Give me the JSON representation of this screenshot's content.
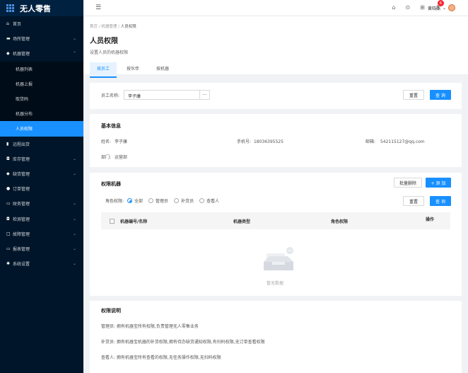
{
  "app": {
    "title": "无人零售"
  },
  "sidebar": {
    "items": [
      {
        "label": "首页",
        "icon": "home-icon",
        "glyph": "⌂",
        "has_children": false
      },
      {
        "label": "场所管理",
        "icon": "place-icon",
        "glyph": "▬",
        "has_children": true
      },
      {
        "label": "机器管理",
        "icon": "machine-icon",
        "glyph": "◆",
        "has_children": true,
        "expanded": true
      },
      {
        "label": "远程出货",
        "icon": "ship-icon",
        "glyph": "▮",
        "has_children": false
      },
      {
        "label": "库存管理",
        "icon": "stock-icon",
        "glyph": "◘",
        "has_children": true
      },
      {
        "label": "缺货管理",
        "icon": "shortage-icon",
        "glyph": "◆",
        "has_children": true
      },
      {
        "label": "订单管理",
        "icon": "order-icon",
        "glyph": "●",
        "has_children": false
      },
      {
        "label": "财务管理",
        "icon": "finance-icon",
        "glyph": "▭",
        "has_children": true
      },
      {
        "label": "检测管理",
        "icon": "detect-icon",
        "glyph": "◘",
        "has_children": true
      },
      {
        "label": "故障管理",
        "icon": "fault-icon",
        "glyph": "□",
        "has_children": true
      },
      {
        "label": "报表管理",
        "icon": "report-icon",
        "glyph": "▭",
        "has_children": true
      },
      {
        "label": "系统设置",
        "icon": "settings-icon",
        "glyph": "✱",
        "has_children": true
      }
    ],
    "machine_sub": [
      "机器列表",
      "机器上报",
      "取货码",
      "机器分布",
      "人员权限"
    ],
    "active_sub": "人员权限"
  },
  "topbar": {
    "notification_count": "6",
    "user_name": "黄晓燕"
  },
  "breadcrumb": [
    "首页",
    "机器管理",
    "人员权限"
  ],
  "page": {
    "title": "人员权限",
    "subtitle": "设置人员的机器权限",
    "tabs": [
      "按员工",
      "按伙伴",
      "按机器"
    ],
    "active_tab": "按员工"
  },
  "search": {
    "label": "员工名称:",
    "value": "李子康",
    "more": "···",
    "reset": "重置",
    "query": "查 询"
  },
  "basic_info": {
    "title": "基本信息",
    "name_label": "姓名:",
    "name_value": "李子康",
    "phone_label": "手机号:",
    "phone_value": "18036395525",
    "email_label": "邮箱:",
    "email_value": "542115127@qq.com",
    "dept_label": "部门:",
    "dept_value": "运营部"
  },
  "perm_machines": {
    "title": "权限机器",
    "batch_delete": "批量删除",
    "add": "+ 添 加",
    "role_label": "角色权限:",
    "roles": [
      "全部",
      "管理员",
      "补货员",
      "查看人"
    ],
    "selected_role": "全部",
    "reset": "重置",
    "query": "查 询",
    "columns": [
      "机器编号/名称",
      "机器类型",
      "角色权限",
      "操作"
    ],
    "empty_text": "暂无数据"
  },
  "perm_desc": {
    "title": "权限说明",
    "lines": [
      "管理员: 拥有机器宝所有权限,负责管理无人零售业务",
      "补货员: 拥有机器宝机器的补货权限,拥有待办缺货通知权限,有扫码权限,无订单查看权限",
      "查看人: 拥有机器宝所有查看的权限,无任务操作权限,无扫码权限"
    ]
  }
}
